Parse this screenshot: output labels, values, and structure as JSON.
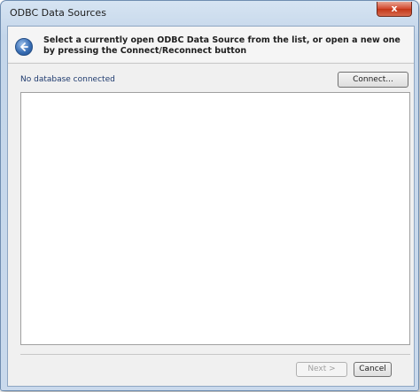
{
  "window": {
    "title": "ODBC Data Sources",
    "close_glyph": "x"
  },
  "header": {
    "back_icon": "back-arrow-icon",
    "instruction": "Select a currently open ODBC Data Source from the list, or open a new one by pressing the Connect/Reconnect button"
  },
  "connection": {
    "status": "No database connected",
    "connect_label": "Connect..."
  },
  "data_sources": [],
  "footer": {
    "next_label": "Next >",
    "cancel_label": "Cancel"
  },
  "colors": {
    "accent": "#3a6fb5",
    "status_text": "#1e3a6e",
    "close_button": "#c23518"
  }
}
